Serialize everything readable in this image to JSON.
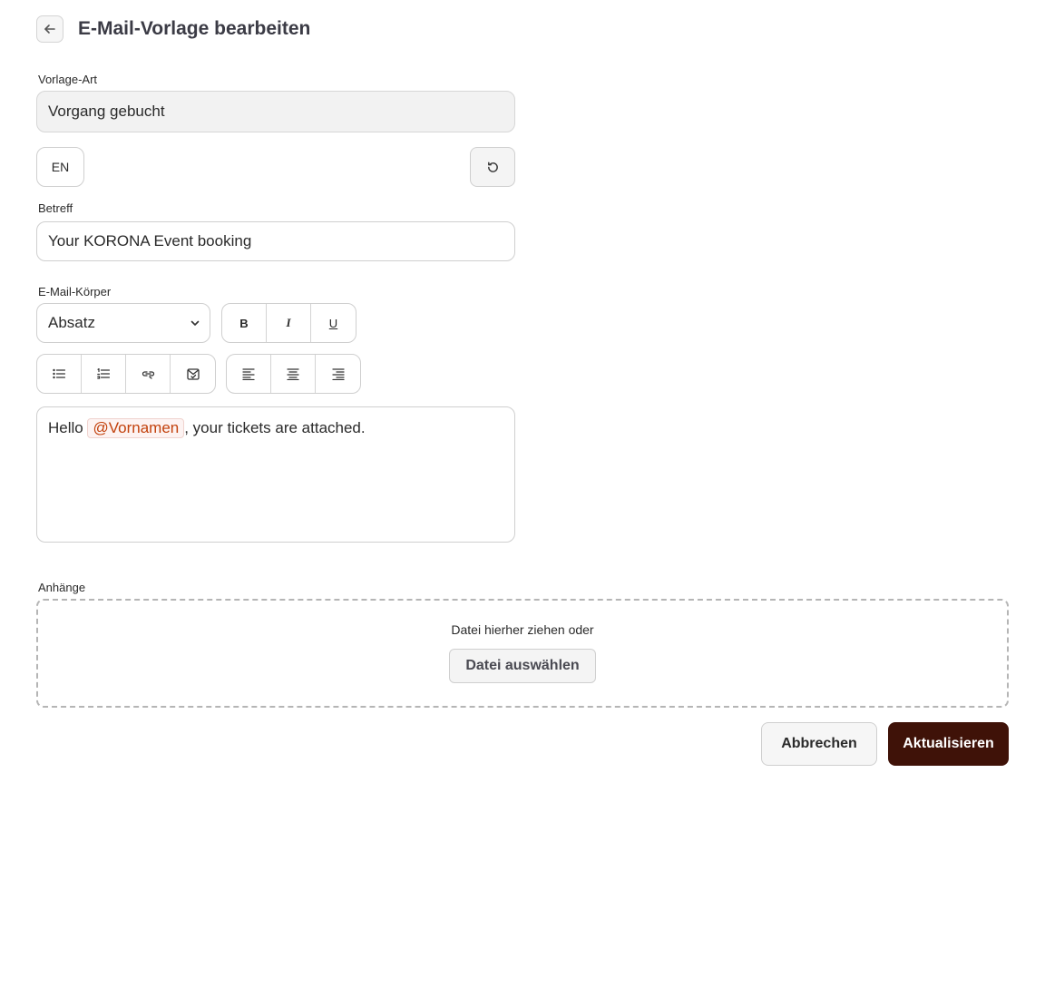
{
  "header": {
    "title": "E-Mail-Vorlage bearbeiten",
    "back_icon": "arrow-left-icon"
  },
  "template_type": {
    "label": "Vorlage-Art",
    "value": "Vorgang gebucht"
  },
  "language": {
    "button_label": "EN",
    "reset_icon": "rotate-ccw-icon"
  },
  "subject": {
    "label": "Betreff",
    "value": "Your KORONA Event booking"
  },
  "body": {
    "label": "E-Mail-Körper",
    "block_format": "Absatz",
    "format_buttons": {
      "bold": "B",
      "italic": "I",
      "underline": "U"
    },
    "toolbar_icons": [
      "bullet-list-icon",
      "numbered-list-icon",
      "link-icon",
      "mail-check-icon",
      "align-left-icon",
      "align-center-icon",
      "align-right-icon"
    ],
    "content_before": "Hello ",
    "mention": "@Vornamen",
    "content_after": ", your tickets are attached."
  },
  "attachments": {
    "label": "Anhänge",
    "drop_text": "Datei hierher ziehen oder",
    "choose_button": "Datei auswählen"
  },
  "actions": {
    "cancel": "Abbrechen",
    "update": "Aktualisieren"
  },
  "colors": {
    "primary": "#3f1208",
    "mention_text": "#c2410c"
  }
}
